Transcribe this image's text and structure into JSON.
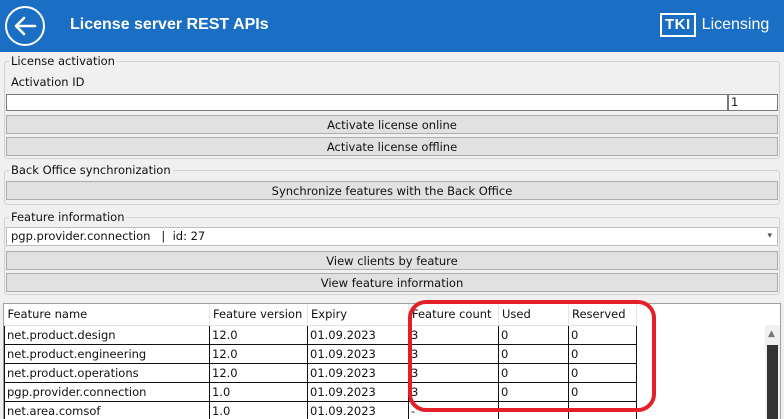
{
  "header": {
    "title": "License server REST APIs",
    "brand_logo": "TKI",
    "brand_name": "Licensing",
    "bg_color": "#1a6fc4"
  },
  "activation": {
    "legend": "License activation",
    "id_label": "Activation ID",
    "id_value": "",
    "count_value": "1",
    "online_label": "Activate license online",
    "offline_label": "Activate license offline"
  },
  "backoffice": {
    "legend": "Back Office synchronization",
    "sync_label": "Synchronize features with the Back Office"
  },
  "feature_info": {
    "legend": "Feature information",
    "selected": "pgp.provider.connection   |  id: 27",
    "clients_label": "View clients by feature",
    "info_label": "View feature information"
  },
  "table": {
    "columns": [
      "Feature name",
      "Feature version",
      "Expiry",
      "Feature count",
      "Used",
      "Reserved"
    ],
    "rows": [
      [
        "net.product.design",
        "12.0",
        "01.09.2023",
        "3",
        "0",
        "0"
      ],
      [
        "net.product.engineering",
        "12.0",
        "01.09.2023",
        "3",
        "0",
        "0"
      ],
      [
        "net.product.operations",
        "12.0",
        "01.09.2023",
        "3",
        "0",
        "0"
      ],
      [
        "pgp.provider.connection",
        "1.0",
        "01.09.2023",
        "3",
        "0",
        "0"
      ],
      [
        "net.area.comsof",
        "1.0",
        "01.09.2023",
        "-",
        "",
        ""
      ]
    ]
  },
  "annotation_color": "#e3202a"
}
